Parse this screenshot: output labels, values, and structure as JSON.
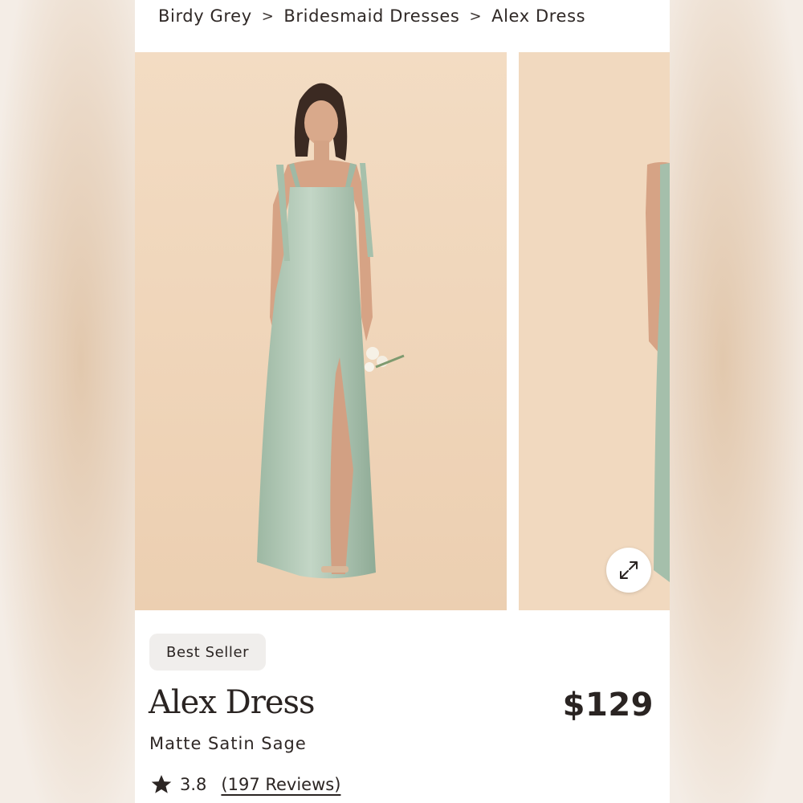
{
  "breadcrumb": {
    "items": [
      "Birdy Grey",
      "Bridesmaid Dresses",
      "Alex Dress"
    ],
    "separator": ">"
  },
  "gallery": {
    "background_color": "#f1d9bf",
    "dress_color": "#a9c2ad",
    "expand_icon": "expand-arrows-icon"
  },
  "product": {
    "badge": "Best Seller",
    "name": "Alex Dress",
    "price": "$129",
    "variant": "Matte Satin Sage",
    "rating": "3.8",
    "reviews": "(197 Reviews)",
    "rating_icon": "star-icon"
  }
}
